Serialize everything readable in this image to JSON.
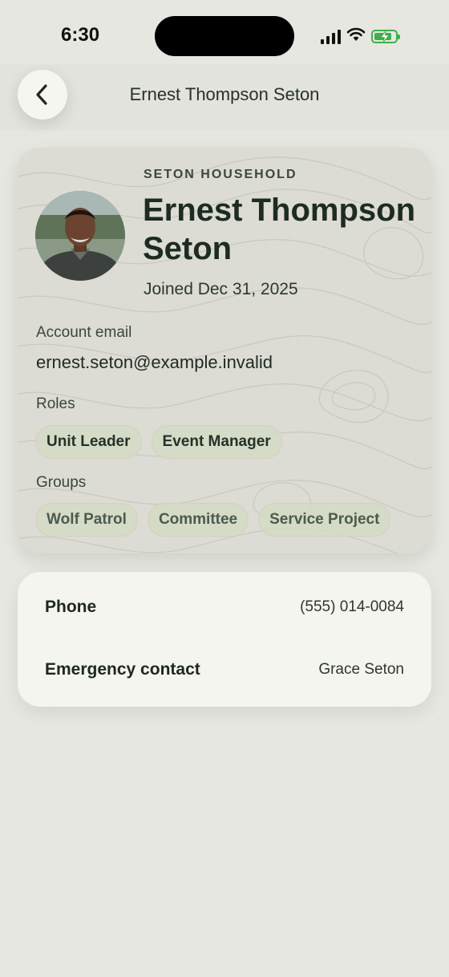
{
  "status_bar": {
    "time": "6:30",
    "icons": [
      "signal-icon",
      "wifi-icon",
      "battery-charging-icon"
    ],
    "battery_color": "#3fae4c"
  },
  "header": {
    "title": "Ernest Thompson Seton",
    "back_icon": "chevron-left-icon"
  },
  "profile": {
    "household": "SETON HOUSEHOLD",
    "name": "Ernest Thompson Seton",
    "joined": "Joined Dec 31, 2025",
    "email_label": "Account email",
    "email": "ernest.seton@example.invalid",
    "roles_label": "Roles",
    "roles": [
      "Unit Leader",
      "Event Manager"
    ],
    "groups_label": "Groups",
    "groups": [
      "Wolf Patrol",
      "Committee",
      "Service Project"
    ]
  },
  "details": {
    "phone_label": "Phone",
    "phone": "(555) 014-0084",
    "emergency_label": "Emergency contact",
    "emergency": "Grace Seton"
  },
  "colors": {
    "background": "#e7e7e1",
    "card": "#dcdcd4",
    "chip": "#d4dac4",
    "text_dark": "#1d2b21"
  }
}
